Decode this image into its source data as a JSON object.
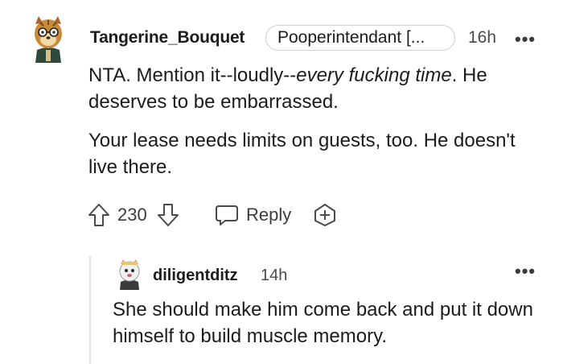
{
  "comment": {
    "username": "Tangerine_Bouquet",
    "flair": "Pooperintendant [...",
    "time": "16h",
    "more": "•••",
    "p1_before": "NTA. Mention it--loudly--",
    "p1_em": "every fucking time",
    "p1_after": ". He deserves to be embarrassed.",
    "p2": "Your lease needs limits on guests, too. He doesn't live there.",
    "score": "230",
    "reply_label": "Reply"
  },
  "reply": {
    "username": "diligentditz",
    "time": "14h",
    "more": "•••",
    "text": "She should make him come back and put it down himself to build muscle memory."
  },
  "icons": {
    "upvote": "arrow-up-icon",
    "downvote": "arrow-down-icon",
    "reply": "speech-bubble-icon",
    "award": "award-plus-icon"
  },
  "colors": {
    "text": "#1c1c1c",
    "meta": "#4a4a4a",
    "border": "#cfcfcf"
  }
}
